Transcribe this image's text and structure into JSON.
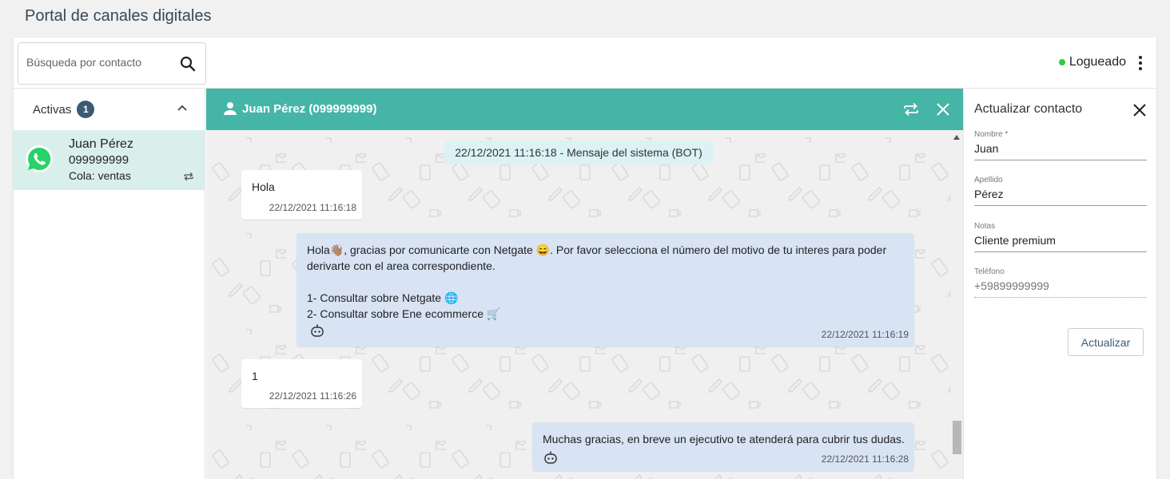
{
  "page": {
    "title": "Portal de canales digitales"
  },
  "topbar": {
    "search_placeholder": "Búsqueda por contacto",
    "status_label": "Logueado",
    "status_color": "#2ecc40"
  },
  "left": {
    "section_label": "Activas",
    "section_count": "1",
    "contacts": [
      {
        "name": "Juan Pérez",
        "phone": "099999999",
        "queue": "Cola: ventas",
        "channel_icon": "whatsapp-icon"
      }
    ]
  },
  "chat": {
    "header_title": "Juan Pérez (099999999)",
    "header_color": "#45b5a7",
    "system_message": "22/12/2021 11:16:18 - Mensaje del sistema (BOT)",
    "messages": [
      {
        "direction": "in",
        "text": "Hola",
        "time": "22/12/2021 11:16:18"
      },
      {
        "direction": "out",
        "text": "Hola👋🏽, gracias por comunicarte con Netgate 😄. Por favor selecciona el número del motivo de tu interes para poder\nderivarte con el area correspondiente.\n\n1- Consultar sobre Netgate 🌐\n2- Consultar sobre Ene ecommerce 🛒",
        "time": "22/12/2021 11:16:19",
        "bot": true
      },
      {
        "direction": "in",
        "text": "1",
        "time": "22/12/2021 11:16:26"
      },
      {
        "direction": "out",
        "text": "Muchas gracias, en breve un ejecutivo te atenderá para cubrir tus dudas.",
        "time": "22/12/2021 11:16:28",
        "bot": true
      }
    ]
  },
  "contact_form": {
    "title": "Actualizar contacto",
    "fields": [
      {
        "label": "Nombre *",
        "value": "Juan"
      },
      {
        "label": "Apellido",
        "value": "Pérez"
      },
      {
        "label": "Notas",
        "value": "Cliente premium"
      },
      {
        "label": "Teléfono",
        "placeholder": "+59899999999"
      }
    ],
    "button_label": "Actualizar"
  }
}
